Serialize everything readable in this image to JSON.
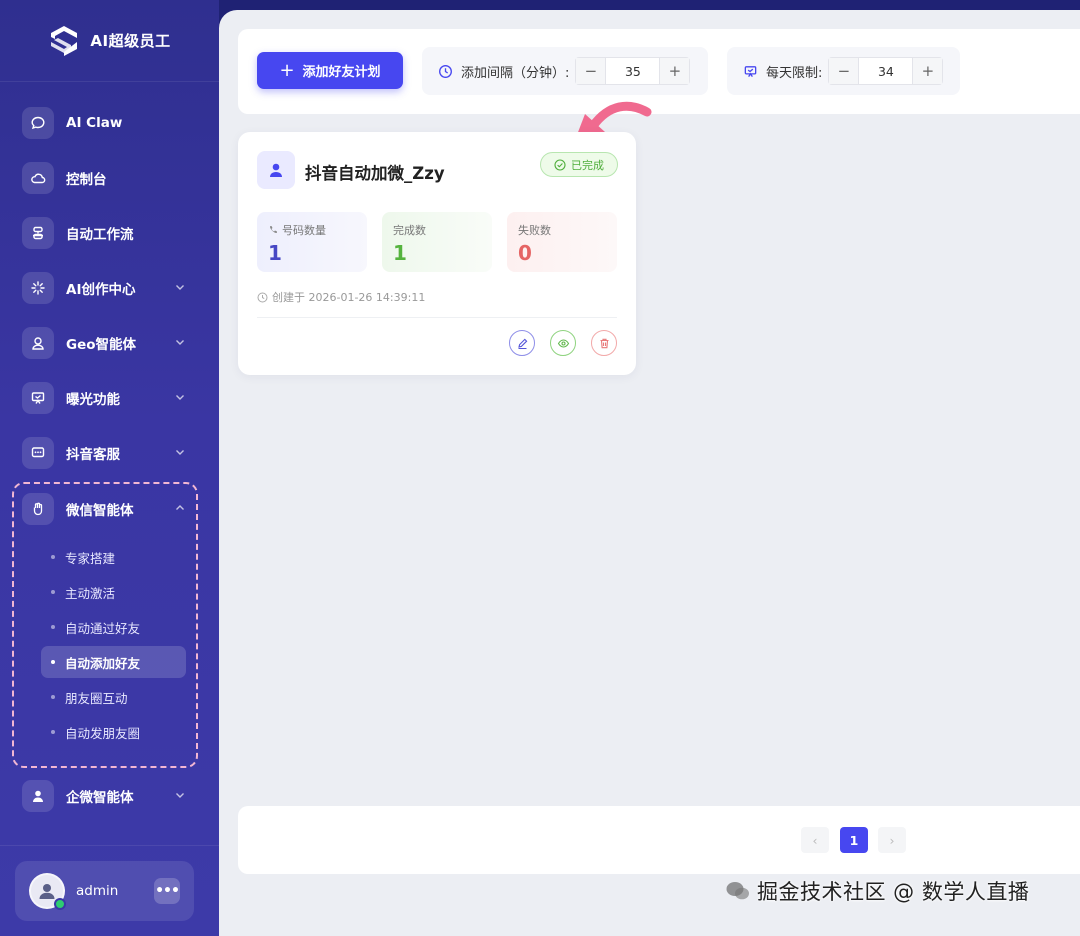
{
  "brand": {
    "title": "AI超级员工"
  },
  "nav": {
    "items": [
      {
        "label": "AI Claw",
        "icon": "chat-bubble-icon"
      },
      {
        "label": "控制台",
        "icon": "cloud-icon"
      },
      {
        "label": "自动工作流",
        "icon": "workflow-icon"
      },
      {
        "label": "AI创作中心",
        "icon": "sparkle-icon",
        "expandable": true
      },
      {
        "label": "Geo智能体",
        "icon": "location-icon",
        "expandable": true
      },
      {
        "label": "曝光功能",
        "icon": "presentation-icon",
        "expandable": true
      },
      {
        "label": "抖音客服",
        "icon": "message-icon",
        "expandable": true
      },
      {
        "label": "微信智能体",
        "icon": "hand-icon",
        "expandable": true,
        "expanded": true
      },
      {
        "label": "企微智能体",
        "icon": "person-icon",
        "expandable": true
      }
    ],
    "wechat_sub": [
      {
        "label": "专家搭建"
      },
      {
        "label": "主动激活"
      },
      {
        "label": "自动通过好友"
      },
      {
        "label": "自动添加好友",
        "active": true
      },
      {
        "label": "朋友圈互动"
      },
      {
        "label": "自动发朋友圈"
      }
    ]
  },
  "user": {
    "name": "admin",
    "more": "•••",
    "status": "online"
  },
  "toolbar": {
    "add_plan_label": "添加好友计划",
    "interval_label": "添加间隔（分钟）:",
    "interval_value": "35",
    "daily_limit_label": "每天限制:",
    "daily_limit_value": "34",
    "minus": "−",
    "plus": "+"
  },
  "plan_card": {
    "title": "抖音自动加微_Zzy",
    "status": "已完成",
    "stats": {
      "numbers_label": "号码数量",
      "numbers_value": "1",
      "done_label": "完成数",
      "done_value": "1",
      "failed_label": "失败数",
      "failed_value": "0"
    },
    "created": "创建于 2026-01-26 14:39:11"
  },
  "pagination": {
    "prev": "‹",
    "current": "1",
    "next": "›"
  },
  "watermark": {
    "text": "掘金技术社区 @ 数学人直播"
  },
  "colors": {
    "accent": "#4747f0",
    "sidebar": "#3a36a3",
    "success": "#55b33e",
    "danger": "#e56464",
    "highlight_dash": "#f2b7d3",
    "arrow": "#f06a8f"
  }
}
